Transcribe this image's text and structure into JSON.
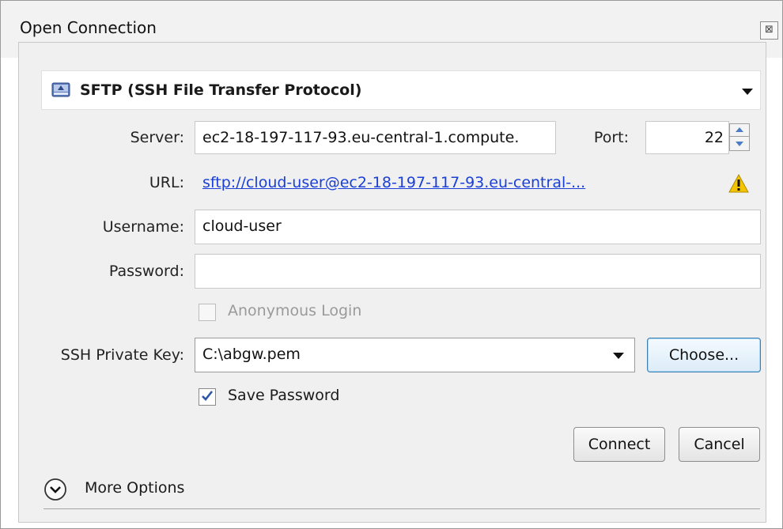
{
  "window": {
    "title": "Open Connection",
    "close_label": "⊠"
  },
  "protocol": {
    "selected": "SFTP (SSH File Transfer Protocol)",
    "icon": "drive-icon"
  },
  "server": {
    "label": "Server:",
    "value": "ec2-18-197-117-93.eu-central-1.compute."
  },
  "port": {
    "label": "Port:",
    "value": "22"
  },
  "url": {
    "label": "URL:",
    "link": "sftp://cloud-user@ec2-18-197-117-93.eu-central-...",
    "warning_icon": "warning-icon"
  },
  "username": {
    "label": "Username:",
    "value": "cloud-user"
  },
  "password": {
    "label": "Password:",
    "value": ""
  },
  "anonymous_login": {
    "label": "Anonymous Login",
    "checked": false,
    "enabled": false
  },
  "ssh_key": {
    "label": "SSH Private Key:",
    "value": "C:\\abgw.pem",
    "choose_label": "Choose..."
  },
  "save_password": {
    "label": "Save Password",
    "checked": true
  },
  "buttons": {
    "connect": "Connect",
    "cancel": "Cancel"
  },
  "more_options": {
    "label": "More Options"
  },
  "colors": {
    "link": "#1a3fd6",
    "warning": "#f5c400",
    "focus_border": "#3c7fb1"
  }
}
